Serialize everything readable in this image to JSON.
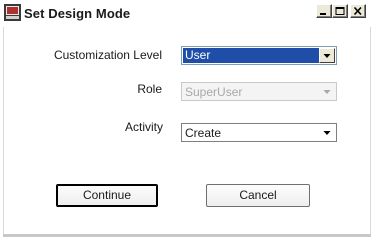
{
  "window": {
    "title": "Set Design Mode",
    "app_icon": "app-icon",
    "controls": [
      "minimize-icon",
      "maximize-icon",
      "close-icon"
    ]
  },
  "form": {
    "customization_level": {
      "label": "Customization Level",
      "value": "User"
    },
    "role": {
      "label": "Role",
      "value": "SuperUser",
      "disabled": true
    },
    "activity": {
      "label": "Activity",
      "value": "Create"
    }
  },
  "buttons": {
    "continue": "Continue",
    "cancel": "Cancel"
  },
  "colors": {
    "selection_highlight": "#1f4ea8",
    "disabled_text": "#a8a8a8"
  }
}
